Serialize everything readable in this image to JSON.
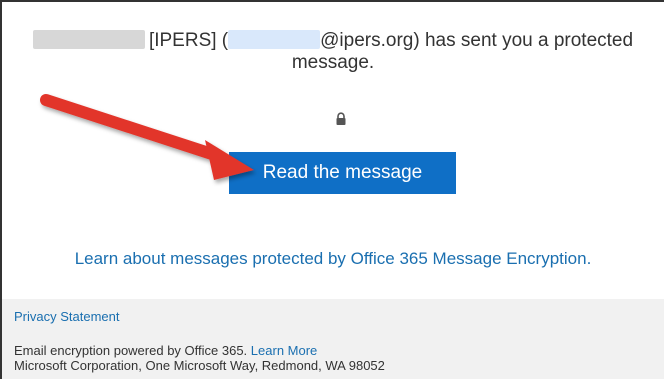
{
  "message": {
    "sender_org": "[IPERS] (",
    "sender_domain": "@ipers.org",
    "sent_text": ") has sent you a protected message.",
    "button_label": "Read the message",
    "learn_link": "Learn about messages protected by Office 365 Message Encryption."
  },
  "footer": {
    "privacy_link": "Privacy Statement",
    "powered_text": "Email encryption powered by Office 365.",
    "learn_more": "Learn More",
    "address": "Microsoft Corporation, One Microsoft Way, Redmond, WA 98052"
  },
  "icons": {
    "lock": "lock-icon",
    "arrow": "red-arrow-annotation"
  },
  "colors": {
    "button": "#0f6fc6",
    "link": "#1a6fb0",
    "arrow": "#e2352b",
    "footer_bg": "#f1f1f1"
  }
}
